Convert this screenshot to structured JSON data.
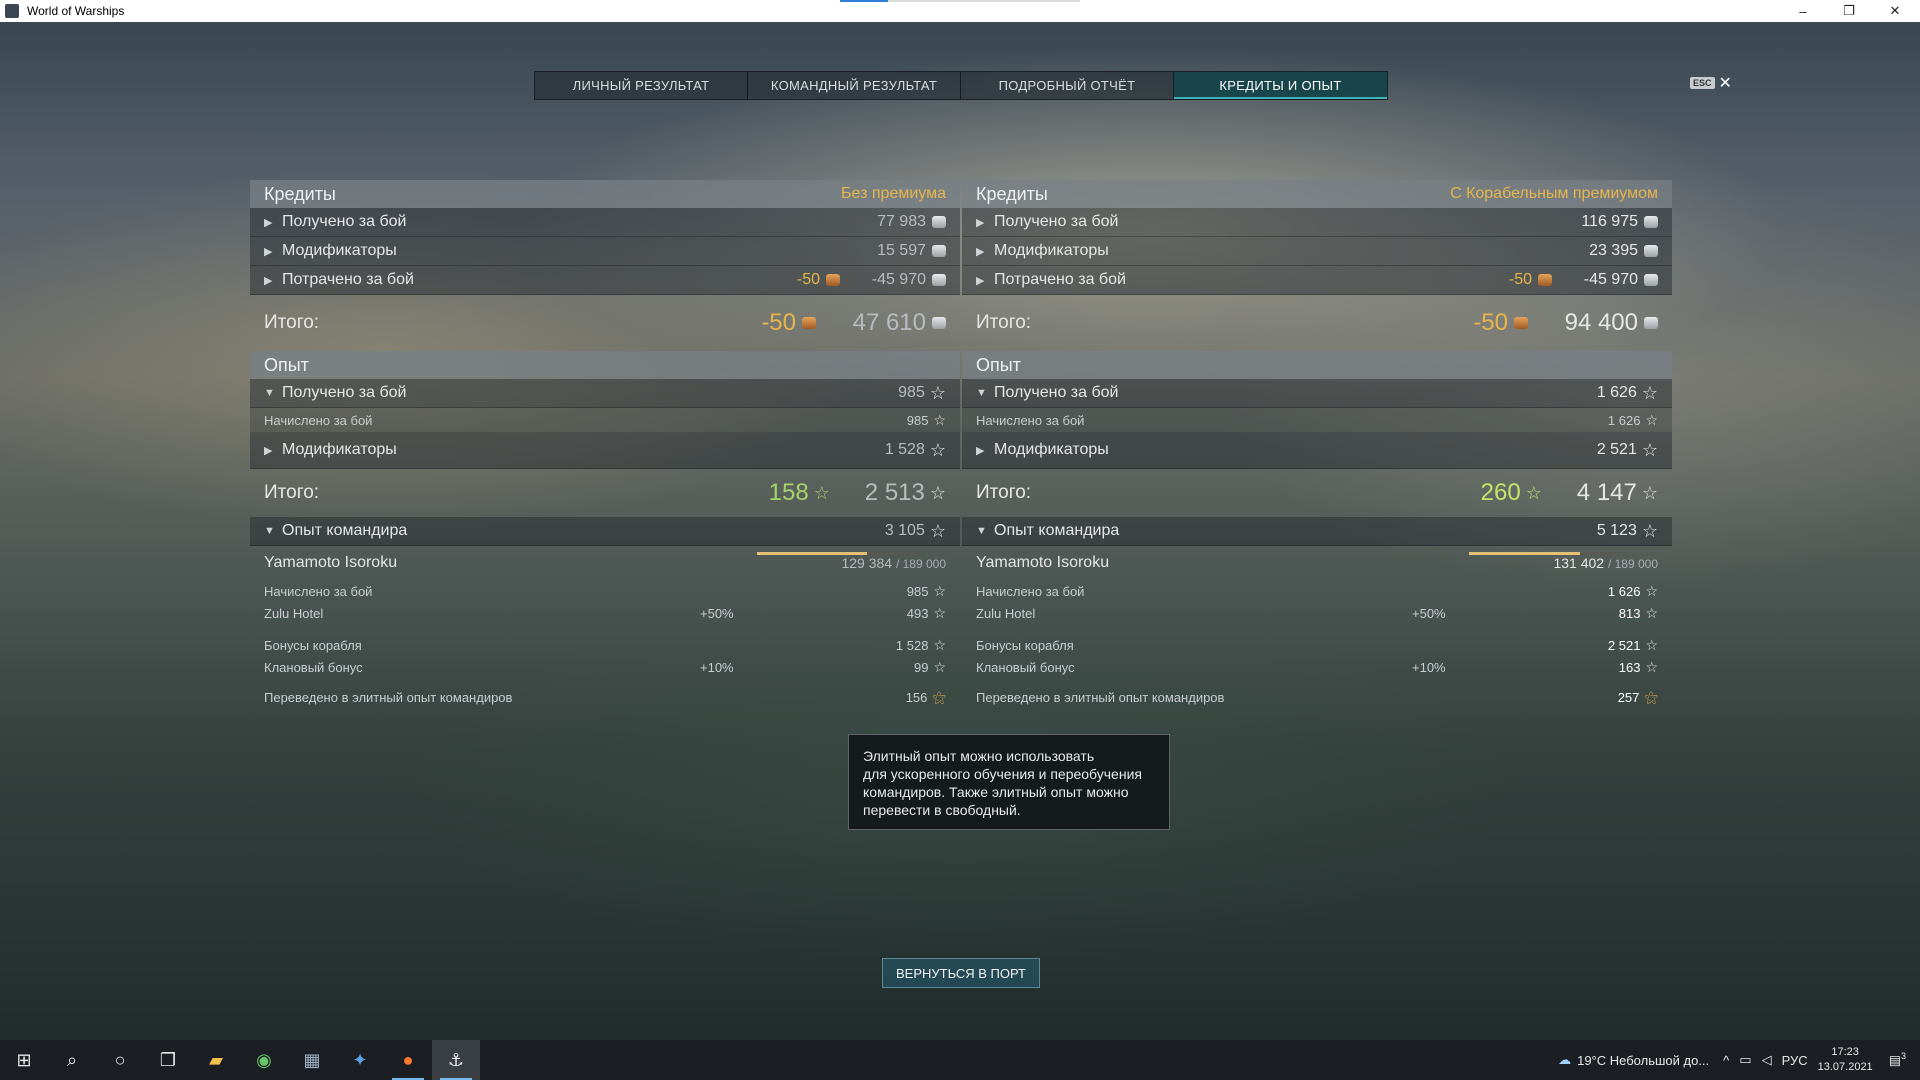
{
  "window": {
    "title": "World of Warships",
    "minimize": "–",
    "maximize": "❐",
    "close": "✕"
  },
  "tabs": [
    {
      "label": "ЛИЧНЫЙ РЕЗУЛЬТАТ"
    },
    {
      "label": "КОМАНДНЫЙ РЕЗУЛЬТАТ"
    },
    {
      "label": "ПОДРОБНЫЙ ОТЧЁТ"
    },
    {
      "label": "КРЕДИТЫ И ОПЫТ",
      "active": true
    }
  ],
  "esc": {
    "key": "ESC",
    "icon": "✕"
  },
  "left": {
    "credits": {
      "title": "Кредиты",
      "mode": "Без премиума",
      "earned": {
        "label": "Получено за бой",
        "value": "77 983"
      },
      "modifiers": {
        "label": "Модификаторы",
        "value": "15 597"
      },
      "spent": {
        "label": "Потрачено за бой",
        "doubloons": "-50",
        "value": "-45 970"
      },
      "total": {
        "label": "Итого:",
        "doubloons": "-50",
        "value": "47 610"
      }
    },
    "xp": {
      "title": "Опыт",
      "earned": {
        "label": "Получено за бой",
        "value": "985"
      },
      "accrued": {
        "label": "Начислено за бой",
        "value": "985"
      },
      "modifiers": {
        "label": "Модификаторы",
        "value": "1 528"
      },
      "total": {
        "label": "Итого:",
        "free": "158",
        "value": "2 513"
      },
      "commander_xp": {
        "label": "Опыт командира",
        "value": "3 105"
      }
    },
    "commander": {
      "name": "Yamamoto Isoroku",
      "xp": "129 384",
      "xp_max": "/ 189 000",
      "progress": 0.685,
      "accrued": {
        "label": "Начислено за бой",
        "value": "985"
      },
      "hotel": {
        "label": "Zulu Hotel",
        "pct": "+50%",
        "value": "493"
      },
      "ship_bonus": {
        "label": "Бонусы корабля",
        "value": "1 528"
      },
      "clan_bonus": {
        "label": "Клановый бонус",
        "pct": "+10%",
        "value": "99"
      },
      "elite": {
        "label": "Переведено в элитный опыт командиров",
        "value": "156"
      }
    }
  },
  "right": {
    "credits": {
      "title": "Кредиты",
      "mode": "С Корабельным премиумом",
      "earned": {
        "label": "Получено за бой",
        "value": "116 975"
      },
      "modifiers": {
        "label": "Модификаторы",
        "value": "23 395"
      },
      "spent": {
        "label": "Потрачено за бой",
        "doubloons": "-50",
        "value": "-45 970"
      },
      "total": {
        "label": "Итого:",
        "doubloons": "-50",
        "value": "94 400"
      }
    },
    "xp": {
      "title": "Опыт",
      "earned": {
        "label": "Получено за бой",
        "value": "1 626"
      },
      "accrued": {
        "label": "Начислено за бой",
        "value": "1 626"
      },
      "modifiers": {
        "label": "Модификаторы",
        "value": "2 521"
      },
      "total": {
        "label": "Итого:",
        "free": "260",
        "value": "4 147"
      },
      "commander_xp": {
        "label": "Опыт командира",
        "value": "5 123"
      }
    },
    "commander": {
      "name": "Yamamoto Isoroku",
      "xp": "131 402",
      "xp_max": "/ 189 000",
      "progress": 0.695,
      "accrued": {
        "label": "Начислено за бой",
        "value": "1 626"
      },
      "hotel": {
        "label": "Zulu Hotel",
        "pct": "+50%",
        "value": "813"
      },
      "ship_bonus": {
        "label": "Бонусы корабля",
        "value": "2 521"
      },
      "clan_bonus": {
        "label": "Клановый бонус",
        "pct": "+10%",
        "value": "163"
      },
      "elite": {
        "label": "Переведено в элитный опыт командиров",
        "value": "257"
      }
    }
  },
  "tooltip": {
    "line1": "Элитный опыт можно использовать",
    "line2": "для ускоренного обучения и переобучения",
    "line3": "командиров. Также элитный опыт можно",
    "line4": "перевести в свободный."
  },
  "return_button": {
    "label": "ВЕРНУТЬСЯ В ПОРТ"
  },
  "taskbar": {
    "weather": "19°C  Небольшой до...",
    "lang": "РУС",
    "time": "17:23",
    "date": "13.07.2021",
    "notifications": "3"
  }
}
